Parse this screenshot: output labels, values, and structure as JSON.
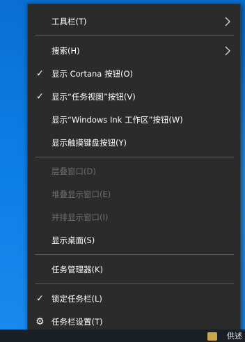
{
  "menu": {
    "toolbars": {
      "label": "工具栏(T)"
    },
    "search": {
      "label": "搜索(H)"
    },
    "show_cortana": {
      "label": "显示 Cortana 按钮(O)",
      "checked": true
    },
    "show_task_view": {
      "label": "显示“任务视图”按钮(V)",
      "checked": true
    },
    "show_ink": {
      "label": "显示“Windows Ink 工作区”按钮(W)"
    },
    "show_touch_keyboard": {
      "label": "显示触摸键盘按钮(Y)"
    },
    "cascade": {
      "label": "层叠窗口(D)",
      "disabled": true
    },
    "stack": {
      "label": "堆叠显示窗口(E)",
      "disabled": true
    },
    "side_by_side": {
      "label": "并排显示窗口(I)",
      "disabled": true
    },
    "show_desktop": {
      "label": "显示桌面(S)"
    },
    "task_manager": {
      "label": "任务管理器(K)"
    },
    "lock_taskbar": {
      "label": "锁定任务栏(L)",
      "checked": true
    },
    "taskbar_settings": {
      "label": "任务栏设置(T)",
      "icon": "gear-icon"
    }
  },
  "glyphs": {
    "check": "✓",
    "gear": "⚙"
  },
  "taskbar": {
    "tray_text": "供述"
  },
  "colors": {
    "menu_bg": "#2b2b2b",
    "text": "#ffffff",
    "disabled_text": "#6e6e6e",
    "separator": "#5c5c5c",
    "desktop": "#0d7de6"
  }
}
